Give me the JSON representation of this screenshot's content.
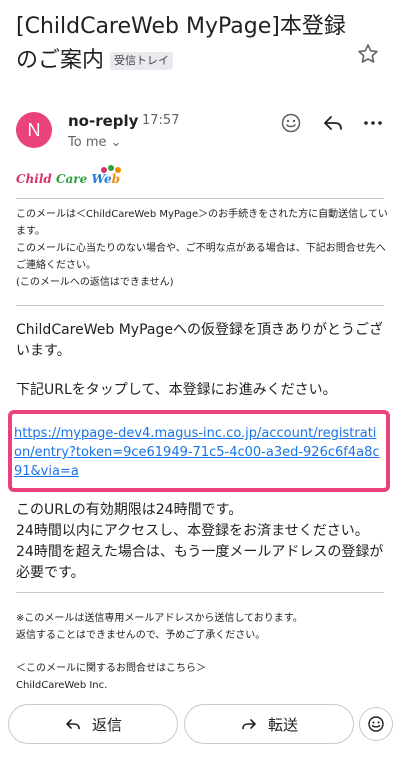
{
  "email": {
    "subject": "[ChildCareWeb MyPage]本登録のご案内",
    "label": "受信トレイ",
    "sender": {
      "initial": "N",
      "name": "no-reply",
      "time": "17:57",
      "to": "To me"
    },
    "logo": {
      "part1": "Child",
      "part2": "Care",
      "part3": "We",
      "part4": "b"
    },
    "notice_lines": [
      "このメールは＜ChildCareWeb MyPage＞のお手続きをされた方に自動送信しています。",
      "このメールに心当たりのない場合や、ご不明な点がある場合は、下記お問合せ先へご連絡ください。",
      "(このメールへの返信はできません)"
    ],
    "thanks": "ChildCareWeb MyPageへの仮登録を頂きありがとうございます。",
    "instruction": "下記URLをタップして、本登録にお進みください。",
    "link": "https://mypage-dev4.magus-inc.co.jp/account/registration/entry?token=9ce61949-71c5-4c00-a3ed-926c6f4a8c91&via=a",
    "expiry_lines": [
      "このURLの有効期限は24時間です。",
      "24時間以内にアクセスし、本登録をお済ませください。",
      "24時間を超えた場合は、もう一度メールアドレスの登録が必要です。"
    ],
    "footer_notes": [
      "※このメールは送信専用メールアドレスから送信しております。",
      "返信することはできませんので、予めご了承ください。"
    ],
    "contact_heading": "＜このメールに関するお問合せはこちら＞",
    "company": "ChildCareWeb Inc."
  },
  "actions": {
    "reply": "返信",
    "forward": "転送"
  },
  "icons": [
    "star-icon",
    "emoji-icon",
    "reply-icon",
    "more-icon",
    "chevron-down-icon",
    "forward-icon"
  ],
  "colors": {
    "avatar": "#e9427d",
    "link": "#1a73e8",
    "highlight": "#e9427d"
  }
}
